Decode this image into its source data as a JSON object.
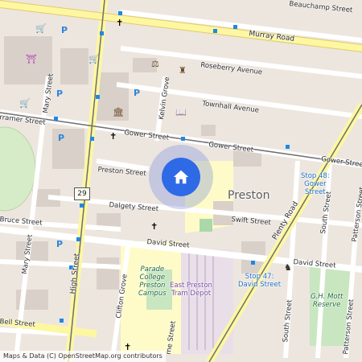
{
  "map": {
    "streets": {
      "beauchamp_street": "Beauchamp Street",
      "murray_road": "Murray Road",
      "roseberry_avenue": "Roseberry Avenue",
      "townhall_avenue": "Townhall Avenue",
      "cramer_street": "Cramer Street",
      "gower_street_west": "Gower Street",
      "gower_street_east": "Gower Street",
      "gower_street_far_east": "Gower Street",
      "preston_street": "Preston Street",
      "dalgety_street": "Dalgety Street",
      "swift_street": "Swift Street",
      "bruce_street": "Bruce Street",
      "david_street_west": "David Street",
      "david_street_east": "David Street",
      "mary_street_north": "Mary Street",
      "mary_street_south": "Mary Street",
      "kelvin_grove": "Kelvin Grove",
      "clifton_grove": "Clifton Grove",
      "high_street": "High Street",
      "plenty_road": "Plenty Road",
      "south_street_upper": "South Street",
      "south_street_lower": "South Street",
      "patterson_street_upper": "Patterson Street",
      "patterson_street_lower": "Patterson Street",
      "bell_street": "Bell Street",
      "cramer_partial": "rramer Street",
      "preston_partial": "Preston Street",
      "grove_partial": "me Street"
    },
    "suburb_label": "Preston",
    "route_shield": "29",
    "tram_stops": {
      "stop_48": "Stop 48:\nGower\nStreet",
      "stop_47": "Stop 47:\nDavid Street"
    },
    "places": {
      "parade_college": "Parade\nCollege\nPreston\nCampus",
      "east_preston_depot": "East Preston\nTram Depot",
      "gh_mott_reserve": "G.H. Mott\nReserve"
    },
    "icons": {
      "location_marker": "home-icon",
      "cross": "church-icon",
      "parking": "parking-icon",
      "shopping": "shopping-cart-icon",
      "courthouse": "courthouse-icon",
      "library": "library-icon",
      "theatre": "theatre-icon",
      "playground": "playground-icon"
    },
    "colors": {
      "background": "#ede6df",
      "major_road": "#fdf7a1",
      "minor_road": "#ffffff",
      "tram_line": "#6e6e6e",
      "building": "#d9d0c9",
      "school": "#fffbc8",
      "park": "#c8e6c0",
      "location": "#2f6ae6",
      "stop_label": "#1e6fbf",
      "parking_blue": "#2e86d9"
    },
    "attribution": "Maps & Data (C) OpenStreetMap.org contributors"
  }
}
